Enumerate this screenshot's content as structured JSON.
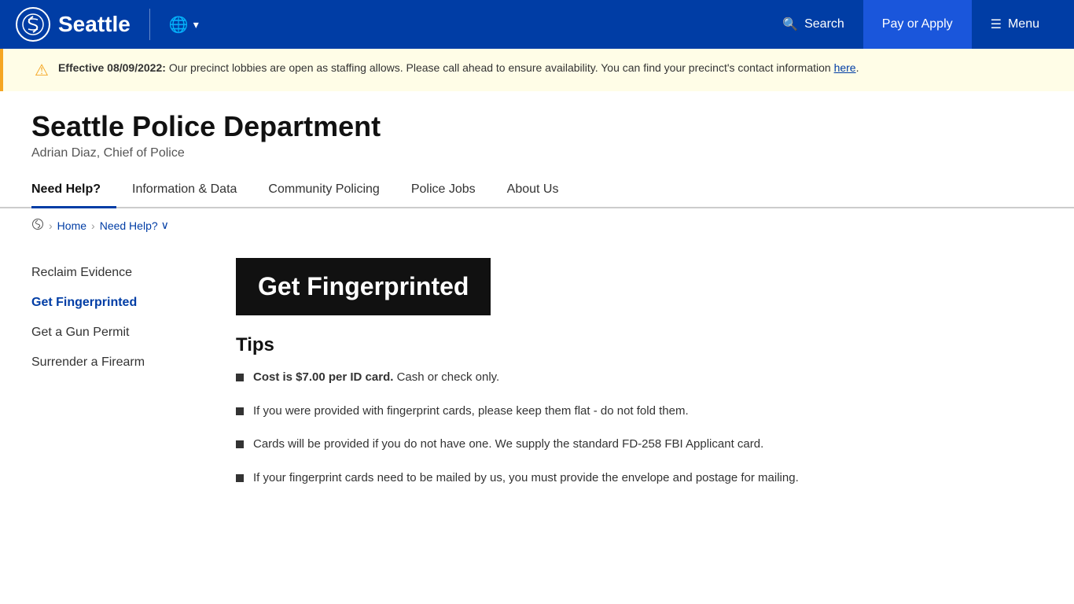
{
  "header": {
    "logo_alt": "Seattle city logo",
    "city_name": "Seattle",
    "translate_label": "Translate",
    "search_label": "Search",
    "pay_apply_label": "Pay or Apply",
    "menu_label": "Menu"
  },
  "alert": {
    "icon": "⚠",
    "heading": "Effective 08/09/2022:",
    "body": "Our precinct lobbies are open as staffing allows. Please call ahead to ensure availability. You can find your precinct's contact information ",
    "link_text": "here",
    "link_url": "#"
  },
  "department": {
    "title": "Seattle Police Department",
    "subtitle": "Adrian Diaz, Chief of Police"
  },
  "nav": {
    "items": [
      {
        "label": "Need Help?",
        "active": true
      },
      {
        "label": "Information & Data",
        "active": false
      },
      {
        "label": "Community Policing",
        "active": false
      },
      {
        "label": "Police Jobs",
        "active": false
      },
      {
        "label": "About Us",
        "active": false
      }
    ]
  },
  "breadcrumb": {
    "home_label": "Home",
    "current_label": "Need Help?",
    "chevron": "∨"
  },
  "sidebar": {
    "items": [
      {
        "label": "Reclaim Evidence",
        "active": false
      },
      {
        "label": "Get Fingerprinted",
        "active": true
      },
      {
        "label": "Get a Gun Permit",
        "active": false
      },
      {
        "label": "Surrender a Firearm",
        "active": false
      }
    ]
  },
  "content": {
    "page_title": "Get Fingerprinted",
    "tips_heading": "Tips",
    "tips": [
      {
        "bold": "Cost is $7.00 per ID card.",
        "rest": " Cash or check only."
      },
      {
        "bold": "",
        "rest": "If you were provided with fingerprint cards, please keep them flat - do not fold them."
      },
      {
        "bold": "",
        "rest": "Cards will be provided if you do not have one.  We supply the standard FD-258 FBI Applicant card."
      },
      {
        "bold": "",
        "rest": "If your fingerprint cards need to be mailed by us, you must provide the envelope and postage for mailing."
      }
    ]
  }
}
